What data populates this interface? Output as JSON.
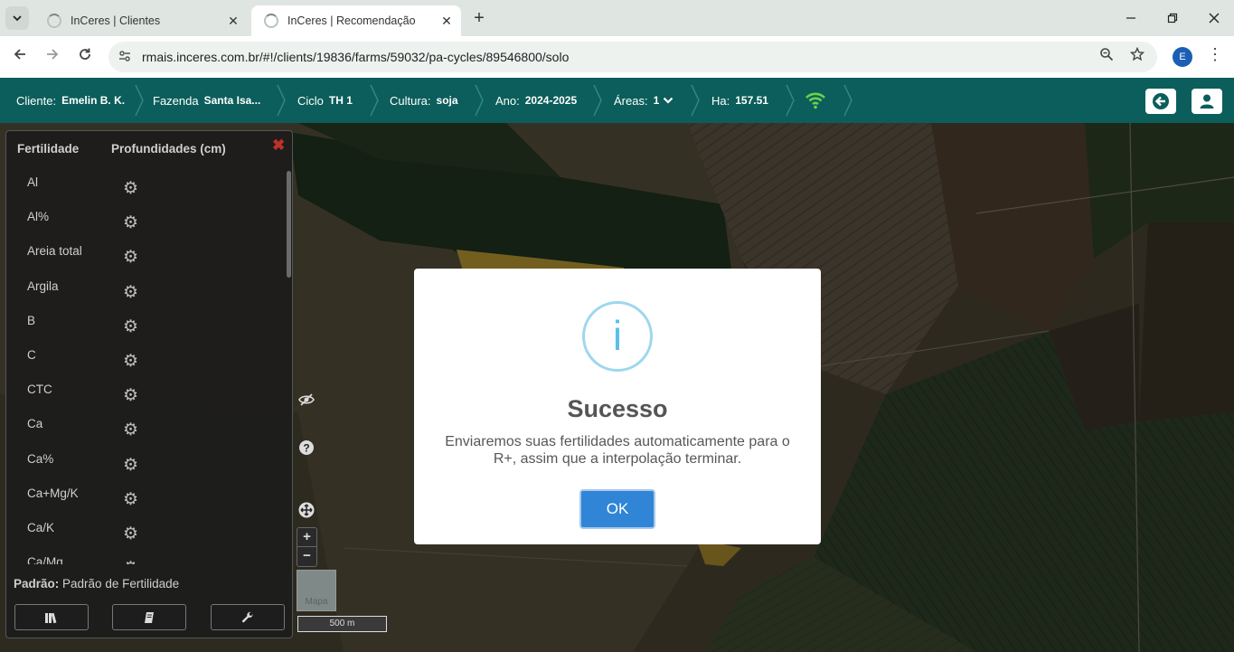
{
  "browser": {
    "tabs": [
      {
        "title": "InCeres | Clientes",
        "active": false
      },
      {
        "title": "InCeres | Recomendação",
        "active": true
      }
    ],
    "url": "rmais.inceres.com.br/#!/clients/19836/farms/59032/pa-cycles/89546800/solo",
    "profile_initial": "E",
    "icons": {
      "tab_search": "chevron-down-icon",
      "new_tab": "plus-icon",
      "back": "arrow-left-icon",
      "forward": "arrow-right-icon",
      "reload": "reload-icon",
      "site_info": "site-settings-icon",
      "zoom": "zoom-icon",
      "bookmark": "star-icon",
      "menu": "kebab-menu-icon"
    }
  },
  "header": {
    "cliente_label": "Cliente:",
    "cliente_value": "Emelin B. K.",
    "fazenda_label": "Fazenda",
    "fazenda_value": "Santa Isa...",
    "ciclo_label": "Ciclo",
    "ciclo_value": "TH 1",
    "cultura_label": "Cultura:",
    "cultura_value": "soja",
    "ano_label": "Ano:",
    "ano_value": "2024-2025",
    "areas_label": "Áreas:",
    "areas_value": "1",
    "ha_label": "Ha:",
    "ha_value": "157.51",
    "colors": {
      "bar": "#0b5e5b",
      "wifi": "#6ad14a"
    }
  },
  "panel": {
    "col1": "Fertilidade",
    "col2": "Profundidades (cm)",
    "items": [
      "Al",
      "Al%",
      "Areia total",
      "Argila",
      "B",
      "C",
      "CTC",
      "Ca",
      "Ca%",
      "Ca+Mg/K",
      "Ca/K",
      "Ca/Mg"
    ],
    "padrao_label": "Padrão:",
    "padrao_value": "Padrão de Fertilidade"
  },
  "map": {
    "layer_label": "Mapa",
    "scale_label": "500 m"
  },
  "modal": {
    "icon": "i",
    "title": "Sucesso",
    "text": "Enviaremos suas fertilidades automaticamente para o R+, assim que a interpolação terminar.",
    "ok_label": "OK",
    "colors": {
      "button": "#3085d6",
      "icon": "#5bc0e8"
    }
  }
}
